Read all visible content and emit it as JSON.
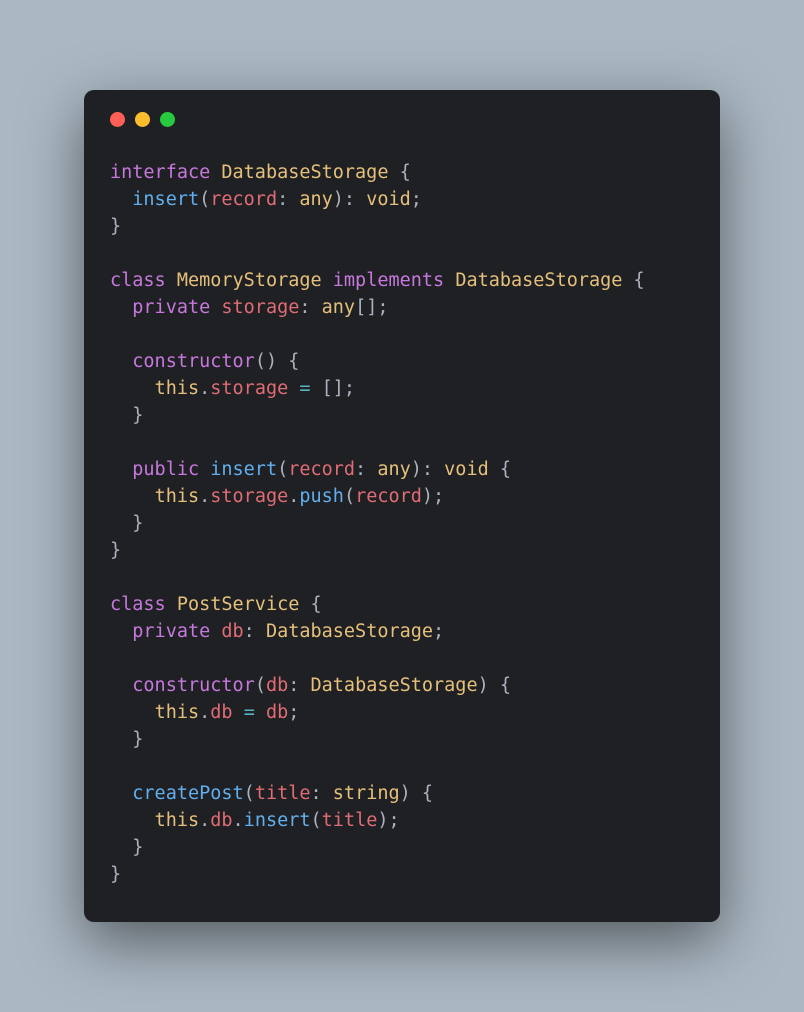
{
  "window": {
    "dots": [
      "red",
      "yellow",
      "green"
    ]
  },
  "code": {
    "t": {
      "interface": "interface",
      "class": "class",
      "implements": "implements",
      "private": "private",
      "public": "public",
      "this": "this",
      "constructor": "constructor",
      "void": "void",
      "any": "any",
      "string": "string",
      "DatabaseStorage": "DatabaseStorage",
      "MemoryStorage": "MemoryStorage",
      "PostService": "PostService",
      "insert": "insert",
      "push": "push",
      "createPost": "createPost",
      "record": "record",
      "storage": "storage",
      "db": "db",
      "title": "title"
    }
  }
}
